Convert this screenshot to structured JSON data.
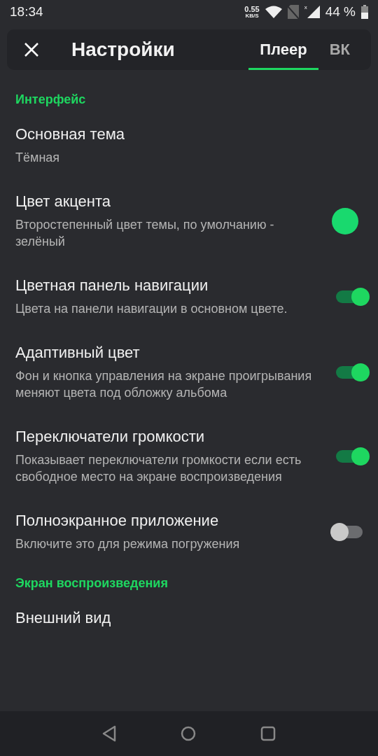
{
  "status_bar": {
    "time": "18:34",
    "speed_value": "0.55",
    "speed_unit": "KB/S",
    "sim_mark": "x",
    "battery": "44 %"
  },
  "header": {
    "title": "Настройки",
    "tabs": [
      {
        "label": "Плеер",
        "selected": true
      },
      {
        "label": "ВК",
        "selected": false
      }
    ]
  },
  "sections": [
    {
      "title": "Интерфейс",
      "items": [
        {
          "kind": "text",
          "title": "Основная тема",
          "subtitle": "Тёмная"
        },
        {
          "kind": "color",
          "title": "Цвет акцента",
          "subtitle": "Второстепенный цвет темы, по умолчанию - зелёный",
          "color": "#19d96e"
        },
        {
          "kind": "switch",
          "title": "Цветная панель навигации",
          "subtitle": "Цвета на панели навигации в основном цвете.",
          "on": true
        },
        {
          "kind": "switch",
          "title": "Адаптивный цвет",
          "subtitle": "Фон и кнопка управления на экране проигрывания меняют цвета под обложку альбома",
          "on": true
        },
        {
          "kind": "switch",
          "title": "Переключатели громкости",
          "subtitle": "Показывает переключатели громкости если есть свободное место на экране воспроизведения",
          "on": true
        },
        {
          "kind": "switch",
          "title": "Полноэкранное приложение",
          "subtitle": "Включите это для режима погружения",
          "on": false
        }
      ]
    },
    {
      "title": "Экран воспроизведения",
      "items": [
        {
          "kind": "text",
          "title": "Внешний вид"
        }
      ]
    }
  ]
}
